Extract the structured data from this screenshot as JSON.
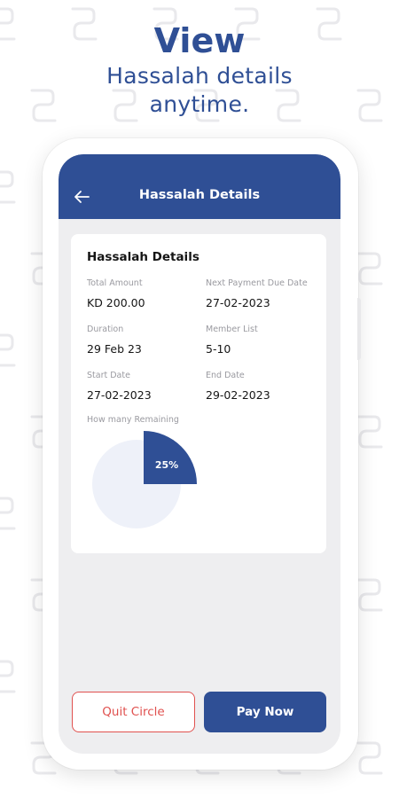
{
  "headline": {
    "line1": "View",
    "line2": "Hassalah details",
    "line3": "anytime."
  },
  "appbar": {
    "title": "Hassalah Details",
    "back_icon": "arrow-left-icon"
  },
  "card": {
    "title": "Hassalah Details",
    "fields": {
      "total_amount": {
        "label": "Total Amount",
        "value": "KD 200.00"
      },
      "next_payment": {
        "label": "Next Payment Due Date",
        "value": "27-02-2023"
      },
      "duration": {
        "label": "Duration",
        "value": "29 Feb 23"
      },
      "member_list": {
        "label": "Member List",
        "value": "5-10"
      },
      "start_date": {
        "label": "Start Date",
        "value": "27-02-2023"
      },
      "end_date": {
        "label": "End Date",
        "value": "29-02-2023"
      }
    },
    "remaining": {
      "label": "How many Remaining",
      "percent_label": "25%",
      "fraction": 0.25
    }
  },
  "buttons": {
    "quit": "Quit Circle",
    "pay": "Pay Now"
  },
  "colors": {
    "primary": "#2f4f95",
    "danger": "#e0514f",
    "screen_bg": "#eeeef0",
    "pie_bg": "#eef1f9"
  }
}
